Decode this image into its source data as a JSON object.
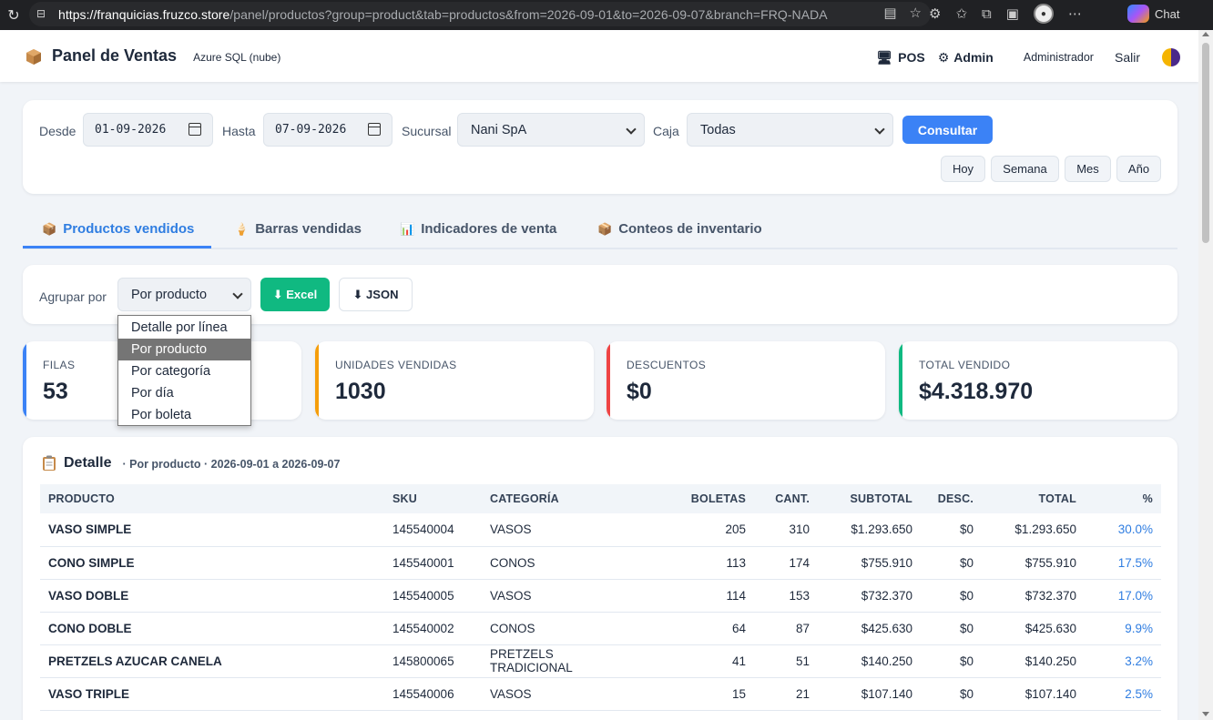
{
  "browser": {
    "url_host": "https://franquicias.fruzco.store",
    "url_rest": "/panel/productos?group=product&tab=productos&from=2026-09-01&to=2026-09-07&branch=FRQ-NADA",
    "chat_label": "Chat"
  },
  "header": {
    "title": "Panel de Ventas",
    "db_label": "Azure SQL (nube)",
    "pos_label": "POS",
    "admin_label": "Admin",
    "user_label": "Administrador",
    "logout_label": "Salir"
  },
  "filters": {
    "desde_label": "Desde",
    "desde_value": "01-09-2026",
    "hasta_label": "Hasta",
    "hasta_value": "07-09-2026",
    "sucursal_label": "Sucursal",
    "sucursal_value": "Nani SpA",
    "caja_label": "Caja",
    "caja_value": "Todas",
    "consultar_label": "Consultar",
    "quick": [
      "Hoy",
      "Semana",
      "Mes",
      "Año"
    ]
  },
  "tabs": [
    {
      "label": "Productos vendidos",
      "icon": "📦"
    },
    {
      "label": "Barras vendidas",
      "icon": "🍦"
    },
    {
      "label": "Indicadores de venta",
      "icon": "📊"
    },
    {
      "label": "Conteos de inventario",
      "icon": "📦"
    }
  ],
  "group": {
    "label": "Agrupar por",
    "value": "Por producto",
    "excel_label": "⬇ Excel",
    "json_label": "⬇ JSON",
    "options": [
      "Detalle por línea",
      "Por producto",
      "Por categoría",
      "Por día",
      "Por boleta"
    ],
    "selected_index": 1
  },
  "stats": [
    {
      "label": "FILAS",
      "value": "53",
      "color": "#3b82f6"
    },
    {
      "label": "UNIDADES VENDIDAS",
      "value": "1030",
      "color": "#f59e0b"
    },
    {
      "label": "DESCUENTOS",
      "value": "$0",
      "color": "#ef4444"
    },
    {
      "label": "TOTAL VENDIDO",
      "value": "$4.318.970",
      "color": "#10b981"
    }
  ],
  "detail": {
    "title": "Detalle",
    "subtitle": "· Por producto · 2026-09-01 a 2026-09-07",
    "columns": [
      "PRODUCTO",
      "SKU",
      "CATEGORÍA",
      "BOLETAS",
      "CANT.",
      "SUBTOTAL",
      "DESC.",
      "TOTAL",
      "%"
    ],
    "rows": [
      [
        "VASO SIMPLE",
        "145540004",
        "VASOS",
        "205",
        "310",
        "$1.293.650",
        "$0",
        "$1.293.650",
        "30.0%"
      ],
      [
        "CONO SIMPLE",
        "145540001",
        "CONOS",
        "113",
        "174",
        "$755.910",
        "$0",
        "$755.910",
        "17.5%"
      ],
      [
        "VASO DOBLE",
        "145540005",
        "VASOS",
        "114",
        "153",
        "$732.370",
        "$0",
        "$732.370",
        "17.0%"
      ],
      [
        "CONO DOBLE",
        "145540002",
        "CONOS",
        "64",
        "87",
        "$425.630",
        "$0",
        "$425.630",
        "9.9%"
      ],
      [
        "PRETZELS AZUCAR CANELA",
        "145800065",
        "PRETZELS TRADICIONAL",
        "41",
        "51",
        "$140.250",
        "$0",
        "$140.250",
        "3.2%"
      ],
      [
        "VASO TRIPLE",
        "145540006",
        "VASOS",
        "15",
        "21",
        "$107.140",
        "$0",
        "$107.140",
        "2.5%"
      ]
    ]
  }
}
